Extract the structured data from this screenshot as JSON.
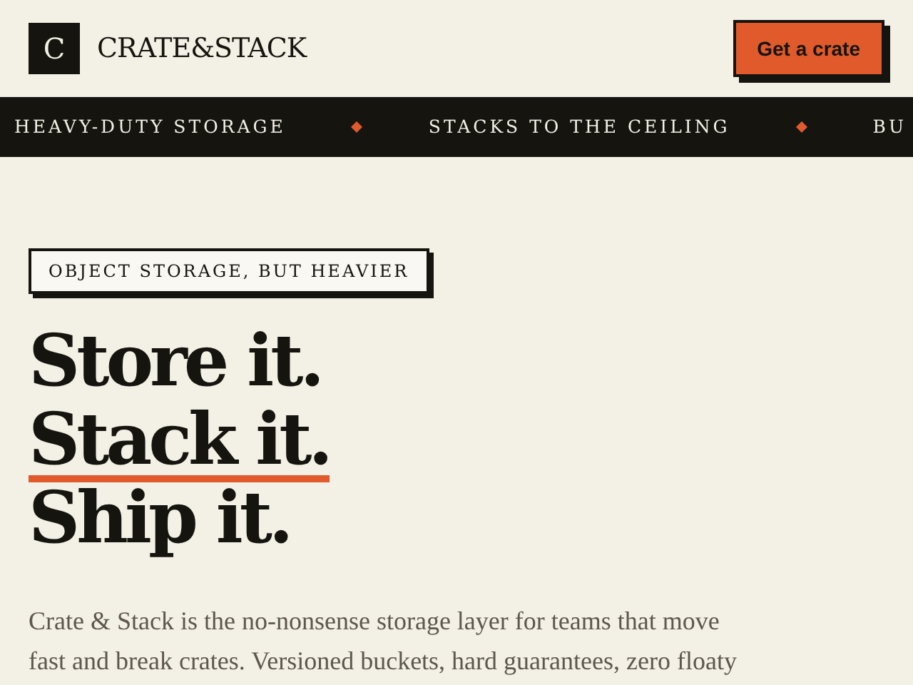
{
  "header": {
    "logo_mark": "C",
    "brand": "CRATE&STACK",
    "cta": "Get a crate"
  },
  "ticker": [
    "HEAVY-DUTY STORAGE",
    "STACKS TO THE CEILING",
    "BU"
  ],
  "hero": {
    "eyebrow": "OBJECT STORAGE, BUT HEAVIER",
    "headline": [
      {
        "text": "Store it.",
        "underlined": false
      },
      {
        "text": "Stack it.",
        "underlined": true
      },
      {
        "text": "Ship it.",
        "underlined": false
      }
    ],
    "intro_lines": [
      "Crate & Stack is the no-nonsense storage layer for teams that move",
      "fast and break crates. Versioned buckets, hard guarantees, zero floaty"
    ]
  }
}
